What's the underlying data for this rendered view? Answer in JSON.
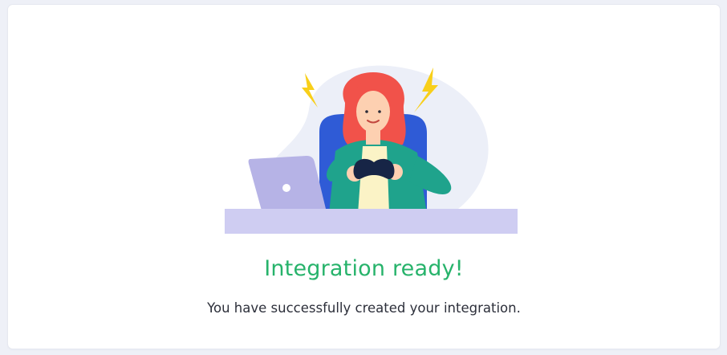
{
  "success": {
    "title": "Integration ready!",
    "message": "You have successfully created your integration."
  },
  "illustration": {
    "name": "woman-with-gamepad-at-desk",
    "colors": {
      "blob": "#eceff8",
      "desk": "#cfcdf2",
      "laptop": "#b6b3e6",
      "chair": "#2f5bd6",
      "jacket": "#1fa38c",
      "shirt": "#fbf3c6",
      "hair": "#f1524a",
      "skin": "#fdd0b1",
      "lightning": "#f8cf1a",
      "gamepad": "#172546"
    }
  },
  "theme": {
    "accent": "#27b36b",
    "text": "#2c2f3a",
    "background": "#eef0f7",
    "card": "#ffffff"
  }
}
